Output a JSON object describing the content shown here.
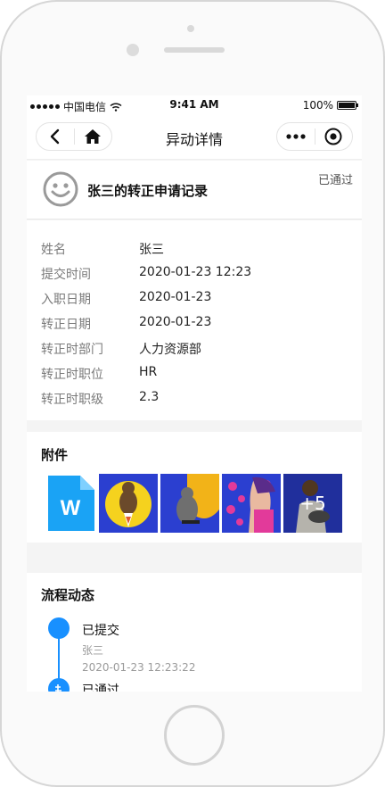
{
  "status_bar": {
    "carrier": "中国电信",
    "time": "9:41 AM",
    "battery": "100%"
  },
  "nav": {
    "title": "异动详情",
    "back_icon": "chevron-left-icon",
    "home_icon": "home-icon",
    "more_icon": "more-dots-icon",
    "record_icon": "target-icon"
  },
  "header": {
    "avatar_icon": "smiley-face-icon",
    "title": "张三的转正申请记录",
    "status": "已通过"
  },
  "info": {
    "rows": [
      {
        "label": "姓名",
        "value": "张三"
      },
      {
        "label": "提交时间",
        "value": "2020-01-23 12:23"
      },
      {
        "label": "入职日期",
        "value": "2020-01-23"
      },
      {
        "label": "转正日期",
        "value": "2020-01-23"
      },
      {
        "label": "转正时部门",
        "value": "人力资源部"
      },
      {
        "label": "转正时职位",
        "value": "HR"
      },
      {
        "label": "转正时职级",
        "value": "2.3"
      }
    ]
  },
  "attachments": {
    "title": "附件",
    "doc_letter": "W",
    "more_count": "+5",
    "items": [
      "word-document-icon",
      "illustration-1",
      "illustration-2",
      "illustration-3",
      "illustration-4"
    ]
  },
  "process": {
    "title": "流程动态",
    "steps": [
      {
        "title": "已提交",
        "person": "张三",
        "time": "2020-01-23 12:23:22"
      },
      {
        "title": "已通过"
      }
    ]
  },
  "colors": {
    "accent": "#1890ff",
    "doc_blue": "#1aa3f5",
    "thumb_bg": "#2b3fd0"
  }
}
